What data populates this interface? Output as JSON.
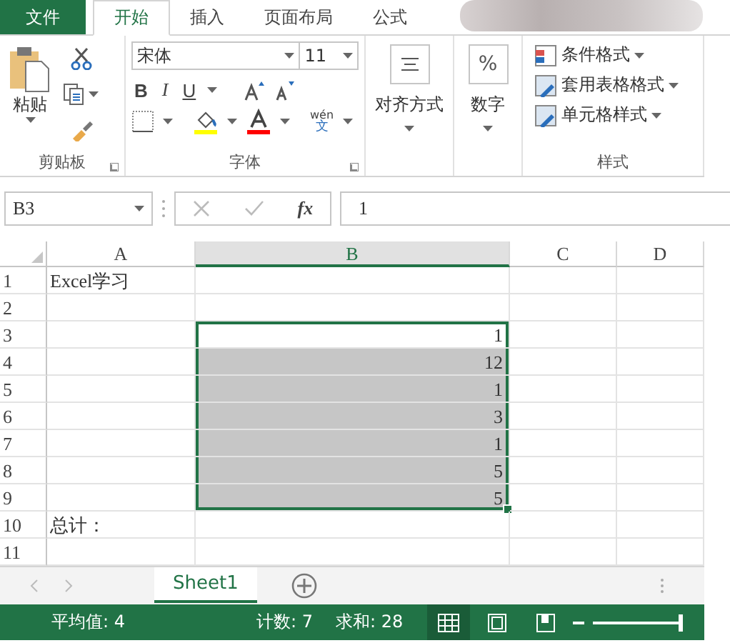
{
  "tabs": [
    {
      "label": "文件",
      "kind": "file",
      "selected": false
    },
    {
      "label": "开始",
      "kind": "tab",
      "selected": true
    },
    {
      "label": "插入",
      "kind": "tab",
      "selected": false
    },
    {
      "label": "页面布局",
      "kind": "tab",
      "selected": false
    },
    {
      "label": "公式",
      "kind": "tab",
      "selected": false
    }
  ],
  "ribbon": {
    "clipboard": {
      "paste": "粘贴",
      "label": "剪贴板"
    },
    "font": {
      "name": "宋体",
      "size": "11",
      "bold": "B",
      "italic": "I",
      "underline": "U",
      "phonetic_top": "wén",
      "phonetic_bottom": "文",
      "label": "字体"
    },
    "alignment": {
      "label": "对齐方式"
    },
    "number": {
      "symbol": "%",
      "label": "数字"
    },
    "styles": {
      "items": [
        "条件格式",
        "套用表格格式",
        "单元格样式"
      ],
      "label": "样式"
    }
  },
  "formula_bar": {
    "name_box": "B3",
    "fx": "fx",
    "value": "1"
  },
  "sheet": {
    "columns": [
      {
        "label": "A",
        "selected": false
      },
      {
        "label": "B",
        "selected": true
      },
      {
        "label": "C",
        "selected": false
      },
      {
        "label": "D",
        "selected": false
      }
    ],
    "rows": [
      {
        "header": "1",
        "cells": [
          {
            "text": "Excel学习",
            "selected": false
          },
          {
            "selected": false
          },
          {
            "selected": false
          },
          {
            "selected": false
          }
        ]
      },
      {
        "header": "2",
        "cells": [
          {
            "selected": false
          },
          {
            "selected": false
          },
          {
            "selected": false
          },
          {
            "selected": false
          }
        ]
      },
      {
        "header": "3",
        "cells": [
          {
            "selected": false
          },
          {
            "text": "1",
            "selected": true,
            "active": true
          },
          {
            "selected": false
          },
          {
            "selected": false
          }
        ]
      },
      {
        "header": "4",
        "cells": [
          {
            "selected": false
          },
          {
            "text": "12",
            "selected": true
          },
          {
            "selected": false
          },
          {
            "selected": false
          }
        ]
      },
      {
        "header": "5",
        "cells": [
          {
            "selected": false
          },
          {
            "text": "1",
            "selected": true
          },
          {
            "selected": false
          },
          {
            "selected": false
          }
        ]
      },
      {
        "header": "6",
        "cells": [
          {
            "selected": false
          },
          {
            "text": "3",
            "selected": true
          },
          {
            "selected": false
          },
          {
            "selected": false
          }
        ]
      },
      {
        "header": "7",
        "cells": [
          {
            "selected": false
          },
          {
            "text": "1",
            "selected": true
          },
          {
            "selected": false
          },
          {
            "selected": false
          }
        ]
      },
      {
        "header": "8",
        "cells": [
          {
            "selected": false
          },
          {
            "text": "5",
            "selected": true
          },
          {
            "selected": false
          },
          {
            "selected": false
          }
        ]
      },
      {
        "header": "9",
        "cells": [
          {
            "selected": false
          },
          {
            "text": "5",
            "selected": true
          },
          {
            "selected": false
          },
          {
            "selected": false
          }
        ]
      },
      {
        "header": "10",
        "cells": [
          {
            "text": "总计：",
            "selected": false
          },
          {
            "selected": false
          },
          {
            "selected": false
          },
          {
            "selected": false
          }
        ]
      },
      {
        "header": "11",
        "cells": [
          {
            "selected": false
          },
          {
            "selected": false
          },
          {
            "selected": false
          },
          {
            "selected": false
          }
        ]
      }
    ]
  },
  "sheet_tabs": [
    {
      "label": "Sheet1",
      "selected": true
    }
  ],
  "status_bar": {
    "average": "平均值: 4",
    "count": "计数: 7",
    "sum": "求和: 28",
    "views": [
      {
        "kind": "normal",
        "selected": true
      },
      {
        "kind": "page_layout",
        "selected": false
      },
      {
        "kind": "page_break",
        "selected": false
      }
    ],
    "zoom": {
      "level": 0.95
    }
  }
}
